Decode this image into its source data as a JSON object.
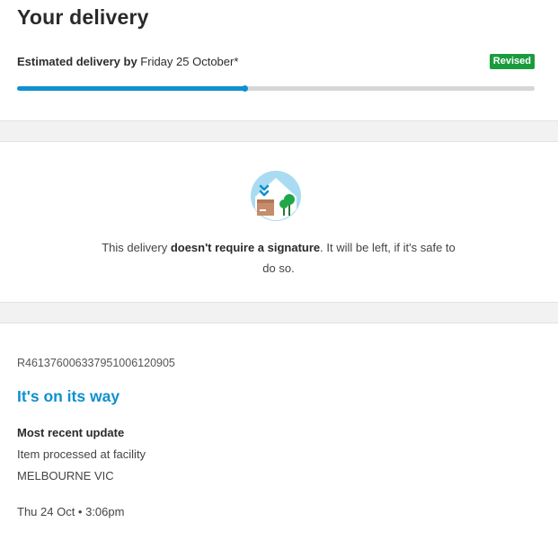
{
  "header": {
    "title": "Your delivery",
    "estimate_label": "Estimated delivery by",
    "estimate_date": "Friday 25 October*",
    "badge": "Revised",
    "progress_fraction": 0.44
  },
  "signature_notice": {
    "text_before": "This delivery ",
    "text_bold": "doesn't require a signature",
    "text_after": ". It will be left, if it's safe to do so.",
    "icon": "parcel-at-house-icon"
  },
  "tracking": {
    "tracking_number": "R461376006337951006120905",
    "status": "It's on its way",
    "recent_update_label": "Most recent update",
    "update_description": "Item processed at facility",
    "update_location": "MELBOURNE VIC",
    "update_time": "Thu 24 Oct • 3:06pm"
  },
  "colors": {
    "accent": "#0f90cf",
    "badge": "#1a9c3e",
    "track": "#d4d6d8",
    "divider_bg": "#f2f2f3"
  }
}
